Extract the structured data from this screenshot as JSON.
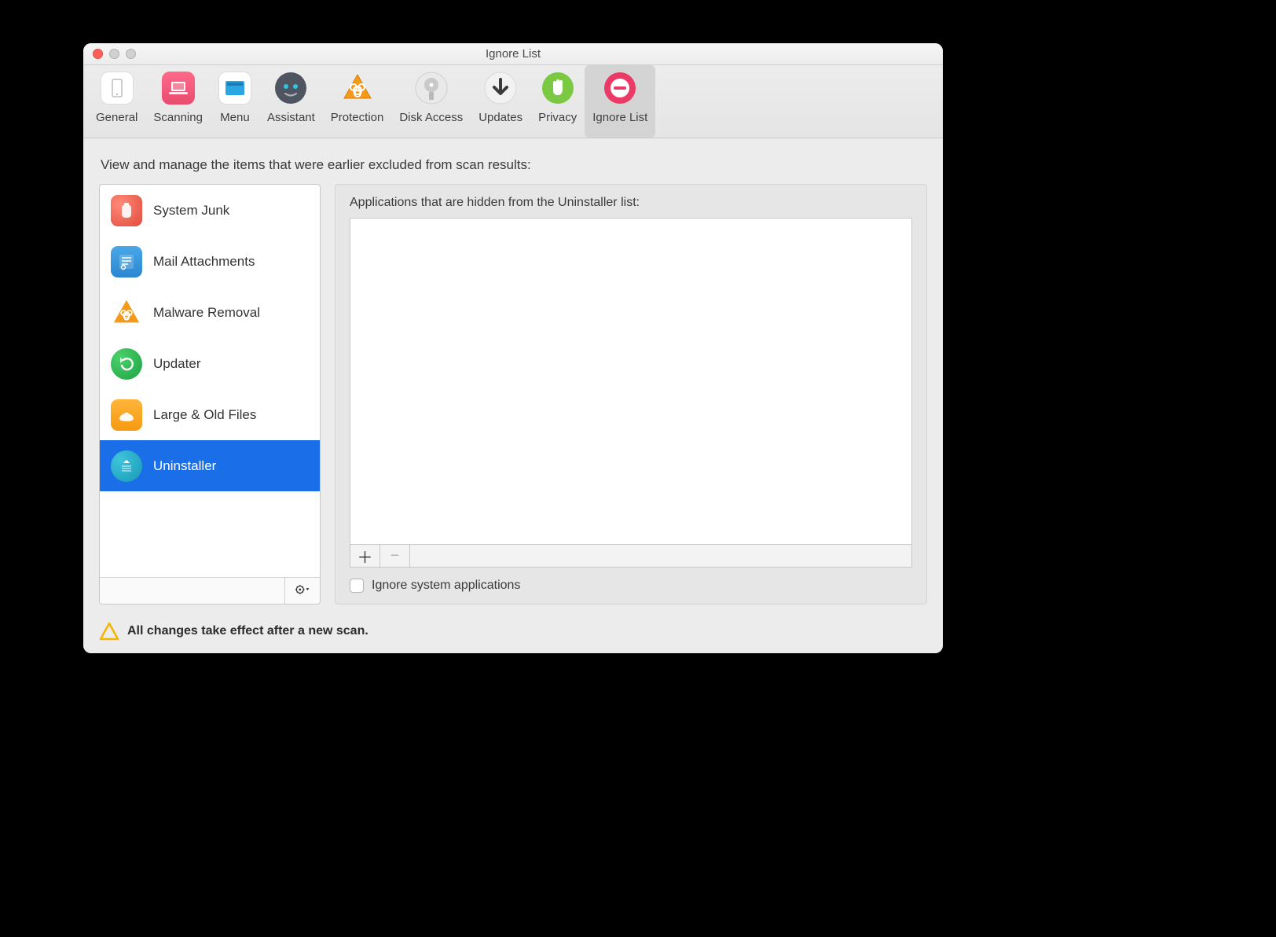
{
  "window": {
    "title": "Ignore List"
  },
  "toolbar": {
    "items": [
      {
        "label": "General"
      },
      {
        "label": "Scanning"
      },
      {
        "label": "Menu"
      },
      {
        "label": "Assistant"
      },
      {
        "label": "Protection"
      },
      {
        "label": "Disk Access"
      },
      {
        "label": "Updates"
      },
      {
        "label": "Privacy"
      },
      {
        "label": "Ignore List"
      }
    ],
    "active_index": 8
  },
  "headline": "View and manage the items that were earlier excluded from scan results:",
  "categories": [
    {
      "label": "System Junk"
    },
    {
      "label": "Mail Attachments"
    },
    {
      "label": "Malware Removal"
    },
    {
      "label": "Updater"
    },
    {
      "label": "Large & Old Files"
    },
    {
      "label": "Uninstaller"
    }
  ],
  "selected_category_index": 5,
  "detail": {
    "title": "Applications that are hidden from the Uninstaller list:",
    "ignore_system_label": "Ignore system applications",
    "ignore_system_checked": false
  },
  "notice": "All changes take effect after a new scan."
}
